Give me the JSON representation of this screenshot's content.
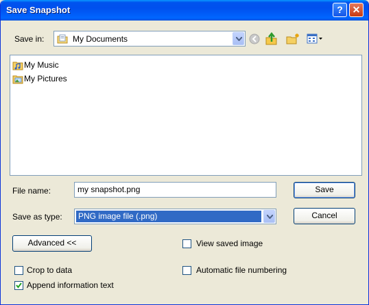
{
  "window": {
    "title": "Save Snapshot",
    "help_glyph": "?",
    "close_glyph": "✕"
  },
  "toolbar": {
    "save_in_label": "Save in:",
    "save_in_value": "My Documents",
    "icons": [
      "back-icon",
      "up-folder-icon",
      "new-folder-icon",
      "view-menu-icon"
    ]
  },
  "files": [
    {
      "name": "My Music",
      "icon": "music-folder-icon"
    },
    {
      "name": "My Pictures",
      "icon": "pictures-folder-icon"
    }
  ],
  "form": {
    "file_name_label": "File name:",
    "file_name_value": "my snapshot.png",
    "save_type_label": "Save as type:",
    "save_type_value": "PNG image file (.png)",
    "save_button": "Save",
    "cancel_button": "Cancel",
    "advanced_button": "Advanced <<"
  },
  "options": {
    "view_saved_image": {
      "label": "View saved image",
      "checked": false
    },
    "crop_to_data": {
      "label": "Crop to data",
      "checked": false
    },
    "automatic_file_numbering": {
      "label": "Automatic file numbering",
      "checked": false
    },
    "append_information_text": {
      "label": "Append information text",
      "checked": true
    }
  },
  "colors": {
    "titlebar": "#0054e3",
    "dialog_bg": "#ece9d8",
    "selection": "#316ac5",
    "check": "#21a121"
  }
}
